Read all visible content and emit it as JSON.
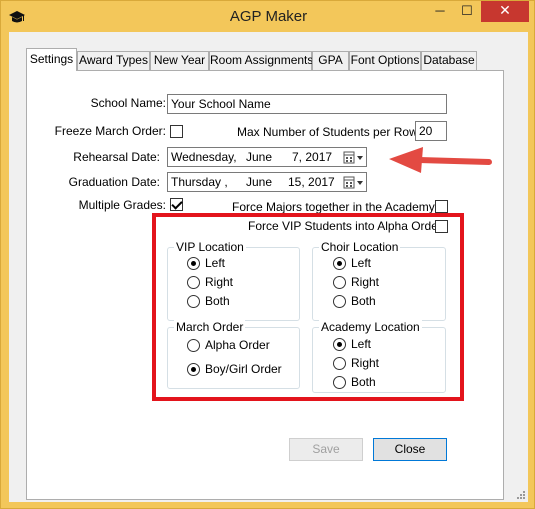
{
  "window": {
    "title": "AGP Maker",
    "controls": {
      "minimize": "─",
      "maximize": "☐",
      "close": "✕"
    },
    "frame_color": "#f3c75a",
    "close_color": "#c7372f"
  },
  "tabs": [
    {
      "label": "Settings",
      "active": true
    },
    {
      "label": "Award Types"
    },
    {
      "label": "New Year"
    },
    {
      "label": "Room Assignments"
    },
    {
      "label": "GPA"
    },
    {
      "label": "Font Options"
    },
    {
      "label": "Database"
    }
  ],
  "form": {
    "school_name_label": "School Name:",
    "school_name_value": "Your School Name",
    "freeze_march_label": "Freeze March Order:",
    "freeze_march_checked": false,
    "max_students_label": "Max Number of Students per Row:",
    "max_students_value": "20",
    "rehearsal_label": "Rehearsal Date:",
    "rehearsal": {
      "weekday": "Wednesday,",
      "month": "June",
      "day": "7, 2017"
    },
    "graduation_label": "Graduation Date:",
    "graduation": {
      "weekday": "Thursday   ,",
      "month": "June",
      "day": "15, 2017"
    },
    "multiple_grades_label": "Multiple Grades:",
    "multiple_grades_checked": true,
    "force_majors_label": "Force Majors together in the Academys",
    "force_majors_checked": false,
    "force_vip_label": "Force VIP Students into Alpha Order",
    "force_vip_checked": false
  },
  "groups": {
    "vip": {
      "title": "VIP Location",
      "options": [
        "Left",
        "Right",
        "Both"
      ],
      "selected": "Left"
    },
    "choir": {
      "title": "Choir Location",
      "options": [
        "Left",
        "Right",
        "Both"
      ],
      "selected": "Left"
    },
    "march": {
      "title": "March Order",
      "options": [
        "Alpha Order",
        "Boy/Girl Order"
      ],
      "selected": "Boy/Girl Order"
    },
    "academy": {
      "title": "Academy Location",
      "options": [
        "Left",
        "Right",
        "Both"
      ],
      "selected": "Left"
    }
  },
  "buttons": {
    "save": "Save",
    "close": "Close"
  },
  "annotation": {
    "highlight_color": "#e3141c",
    "arrow_color": "#e34a42"
  },
  "icons": {
    "app": "graduation-cap-icon",
    "calendar": "calendar-icon",
    "dropdown": "chevron-down-icon"
  }
}
